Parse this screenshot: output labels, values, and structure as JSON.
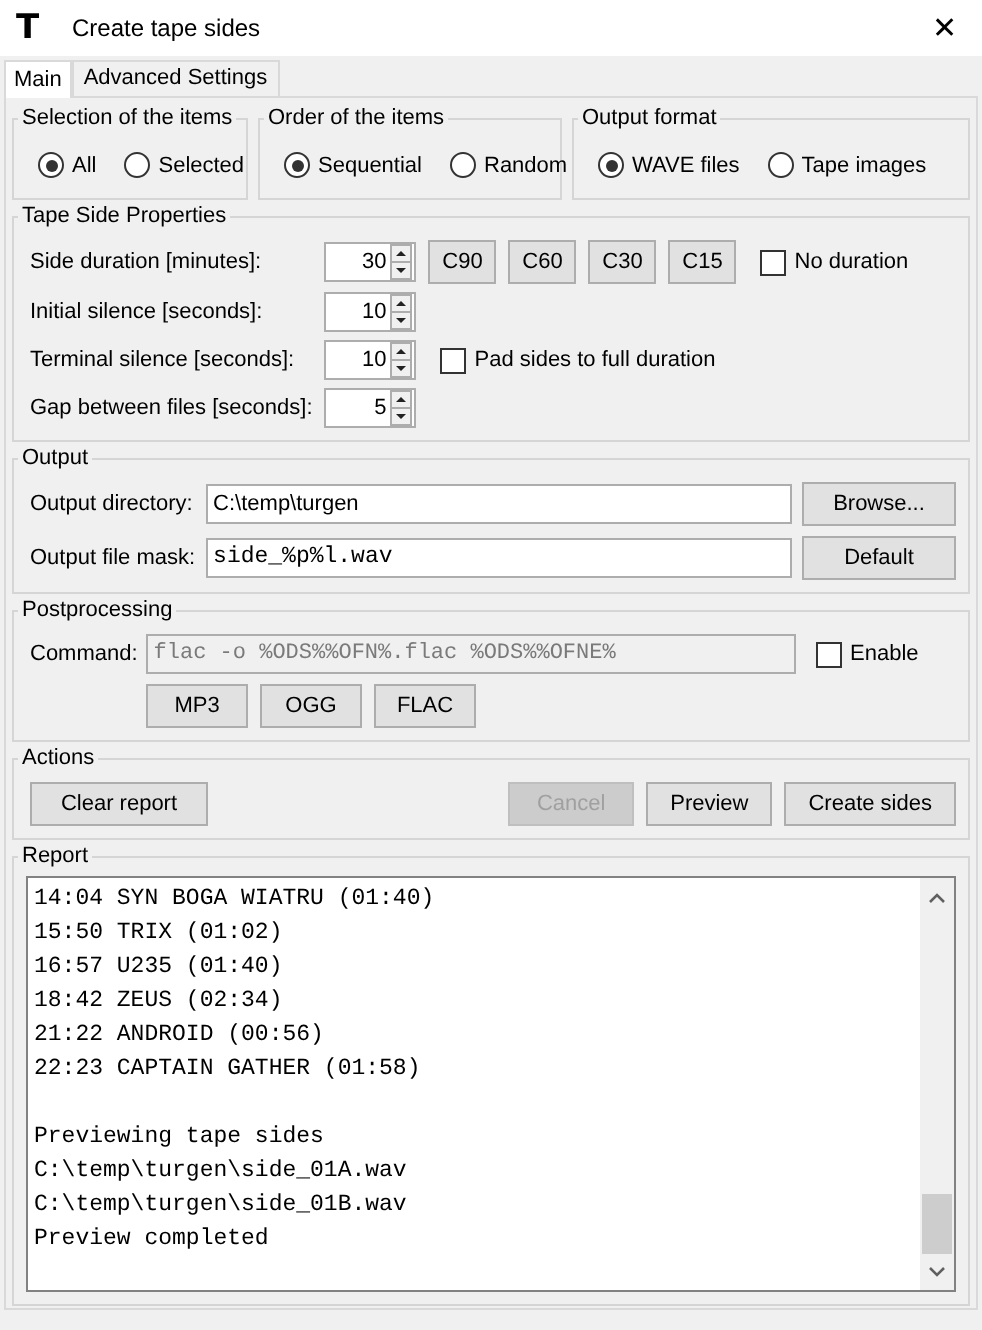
{
  "window": {
    "app_icon": "T",
    "title": "Create tape sides",
    "close": "✕"
  },
  "tabs": [
    {
      "label": "Main",
      "selected": true
    },
    {
      "label": "Advanced Settings",
      "selected": false
    }
  ],
  "radio_groups": [
    {
      "title": "Selection of the items",
      "options": [
        {
          "label": "All",
          "selected": true
        },
        {
          "label": "Selected",
          "selected": false
        }
      ]
    },
    {
      "title": "Order of the items",
      "options": [
        {
          "label": "Sequential",
          "selected": true
        },
        {
          "label": "Random",
          "selected": false
        }
      ]
    },
    {
      "title": "Output format",
      "options": [
        {
          "label": "WAVE files",
          "selected": true
        },
        {
          "label": "Tape images",
          "selected": false
        }
      ]
    }
  ],
  "tape_side_properties": {
    "title": "Tape Side Properties",
    "rows": [
      {
        "label": "Side duration [minutes]:",
        "value": "30",
        "buttons": [
          "C90",
          "C60",
          "C30",
          "C15"
        ],
        "checkbox": {
          "label": "No duration",
          "checked": false
        }
      },
      {
        "label": "Initial silence [seconds]:",
        "value": "10"
      },
      {
        "label": "Terminal silence [seconds]:",
        "value": "10",
        "checkbox": {
          "label": "Pad sides to full duration",
          "checked": false
        }
      },
      {
        "label": "Gap between files [seconds]:",
        "value": "5"
      }
    ]
  },
  "output": {
    "title": "Output",
    "fields": [
      {
        "label": "Output directory:",
        "value": "C:\\temp\\turgen",
        "monospace": false,
        "button": "Browse..."
      },
      {
        "label": "Output file mask:",
        "value": "side_%p%l.wav",
        "monospace": true,
        "button": "Default"
      }
    ]
  },
  "postprocessing": {
    "title": "Postprocessing",
    "command_label": "Command:",
    "command": "flac -o %ODS%%OFN%.flac %ODS%%OFNE%",
    "disabled": true,
    "enable": {
      "label": "Enable",
      "checked": false
    },
    "presets": [
      "MP3",
      "OGG",
      "FLAC"
    ]
  },
  "actions": {
    "title": "Actions",
    "left_buttons": [
      {
        "label": "Clear report",
        "disabled": false
      }
    ],
    "right_buttons": [
      {
        "label": "Cancel",
        "disabled": true
      },
      {
        "label": "Preview",
        "disabled": false
      },
      {
        "label": "Create sides",
        "disabled": false
      }
    ]
  },
  "report": {
    "title": "Report",
    "lines": [
      {
        "text": "14:04 SYN BOGA WIATRU (01:40)",
        "blank_before": false
      },
      {
        "text": "15:50 TRIX (01:02)",
        "blank_before": false
      },
      {
        "text": "16:57 U235 (01:40)",
        "blank_before": false
      },
      {
        "text": "18:42 ZEUS (02:34)",
        "blank_before": false
      },
      {
        "text": "21:22 ANDROID (00:56)",
        "blank_before": false
      },
      {
        "text": "22:23 CAPTAIN GATHER (01:58)",
        "blank_before": false
      },
      {
        "text": "Previewing tape sides",
        "blank_before": true
      },
      {
        "text": "C:\\temp\\turgen\\side_01A.wav",
        "blank_before": false
      },
      {
        "text": "C:\\temp\\turgen\\side_01B.wav",
        "blank_before": false
      },
      {
        "text": "Preview completed",
        "blank_before": false
      }
    ]
  }
}
